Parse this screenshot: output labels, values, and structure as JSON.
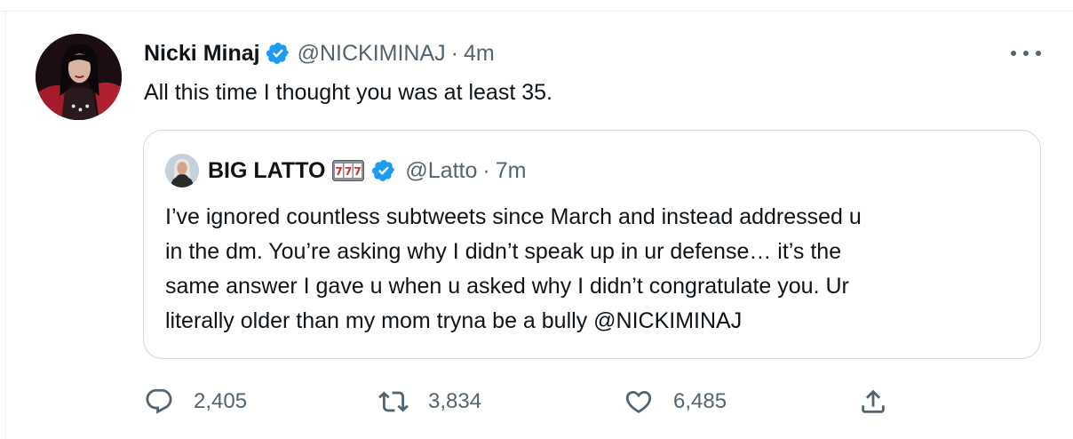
{
  "tweet": {
    "author_name": "Nicki Minaj",
    "author_handle": "@NICKIMINAJ",
    "separator": "·",
    "time": "4m",
    "text": "All this time I thought you was at least 35."
  },
  "quote": {
    "author_name": "BIG LATTO",
    "author_handle": "@Latto",
    "separator": "·",
    "time": "7m",
    "lines": [
      "I’ve ignored countless subtweets since March and instead addressed u",
      "in the dm. You’re asking why I didn’t speak up in ur defense… it’s the",
      "same answer I gave u when u asked why I didn’t congratulate you. Ur",
      "literally older than my mom tryna be a bully @NICKIMINAJ"
    ]
  },
  "actions": {
    "replies": "2,405",
    "retweets": "3,834",
    "likes": "6,485"
  },
  "icons": {
    "verified": "verified-badge-icon",
    "more": "more-options-icon",
    "slot": "slot-machine-777-icon",
    "reply": "reply-icon",
    "retweet": "retweet-icon",
    "like": "heart-icon",
    "share": "share-icon"
  },
  "colors": {
    "text": "#0f1419",
    "secondary": "#536471",
    "verified": "#1d9bf0",
    "border": "#cfd9de"
  }
}
